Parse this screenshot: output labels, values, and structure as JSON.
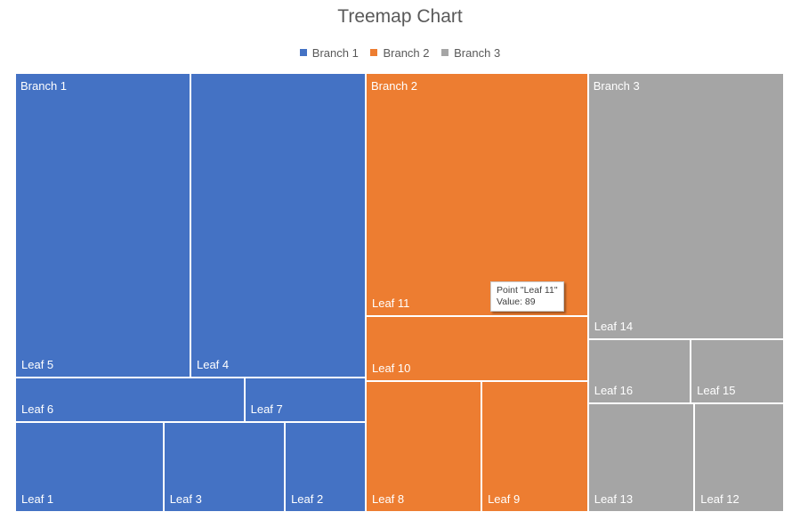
{
  "chart_data": {
    "type": "treemap",
    "title": "Treemap Chart",
    "legend": {
      "placement": "top",
      "entries": [
        {
          "name": "Branch 1",
          "color": "#4472C4"
        },
        {
          "name": "Branch 2",
          "color": "#ED7D31"
        },
        {
          "name": "Branch 3",
          "color": "#A5A5A5"
        }
      ]
    },
    "branches": [
      {
        "name": "Branch 1",
        "color": "#4472C4",
        "leaves": [
          {
            "name": "Leaf 5",
            "value": 88
          },
          {
            "name": "Leaf 4",
            "value": 88
          },
          {
            "name": "Leaf 6",
            "value": 17
          },
          {
            "name": "Leaf 7",
            "value": 9
          },
          {
            "name": "Leaf 1",
            "value": 22
          },
          {
            "name": "Leaf 3",
            "value": 18
          },
          {
            "name": "Leaf 2",
            "value": 12
          }
        ]
      },
      {
        "name": "Branch 2",
        "color": "#ED7D31",
        "leaves": [
          {
            "name": "Leaf 11",
            "value": 89
          },
          {
            "name": "Leaf 10",
            "value": 24
          },
          {
            "name": "Leaf 8",
            "value": 25
          },
          {
            "name": "Leaf 9",
            "value": 23
          }
        ]
      },
      {
        "name": "Branch 3",
        "color": "#A5A5A5",
        "leaves": [
          {
            "name": "Leaf 14",
            "value": 86
          },
          {
            "name": "Leaf 16",
            "value": 11
          },
          {
            "name": "Leaf 15",
            "value": 10
          },
          {
            "name": "Leaf 13",
            "value": 19
          },
          {
            "name": "Leaf 12",
            "value": 16
          }
        ]
      }
    ]
  },
  "tooltip": {
    "point_label": "Point \"Leaf 11\"",
    "value_label": "Value: 89"
  }
}
